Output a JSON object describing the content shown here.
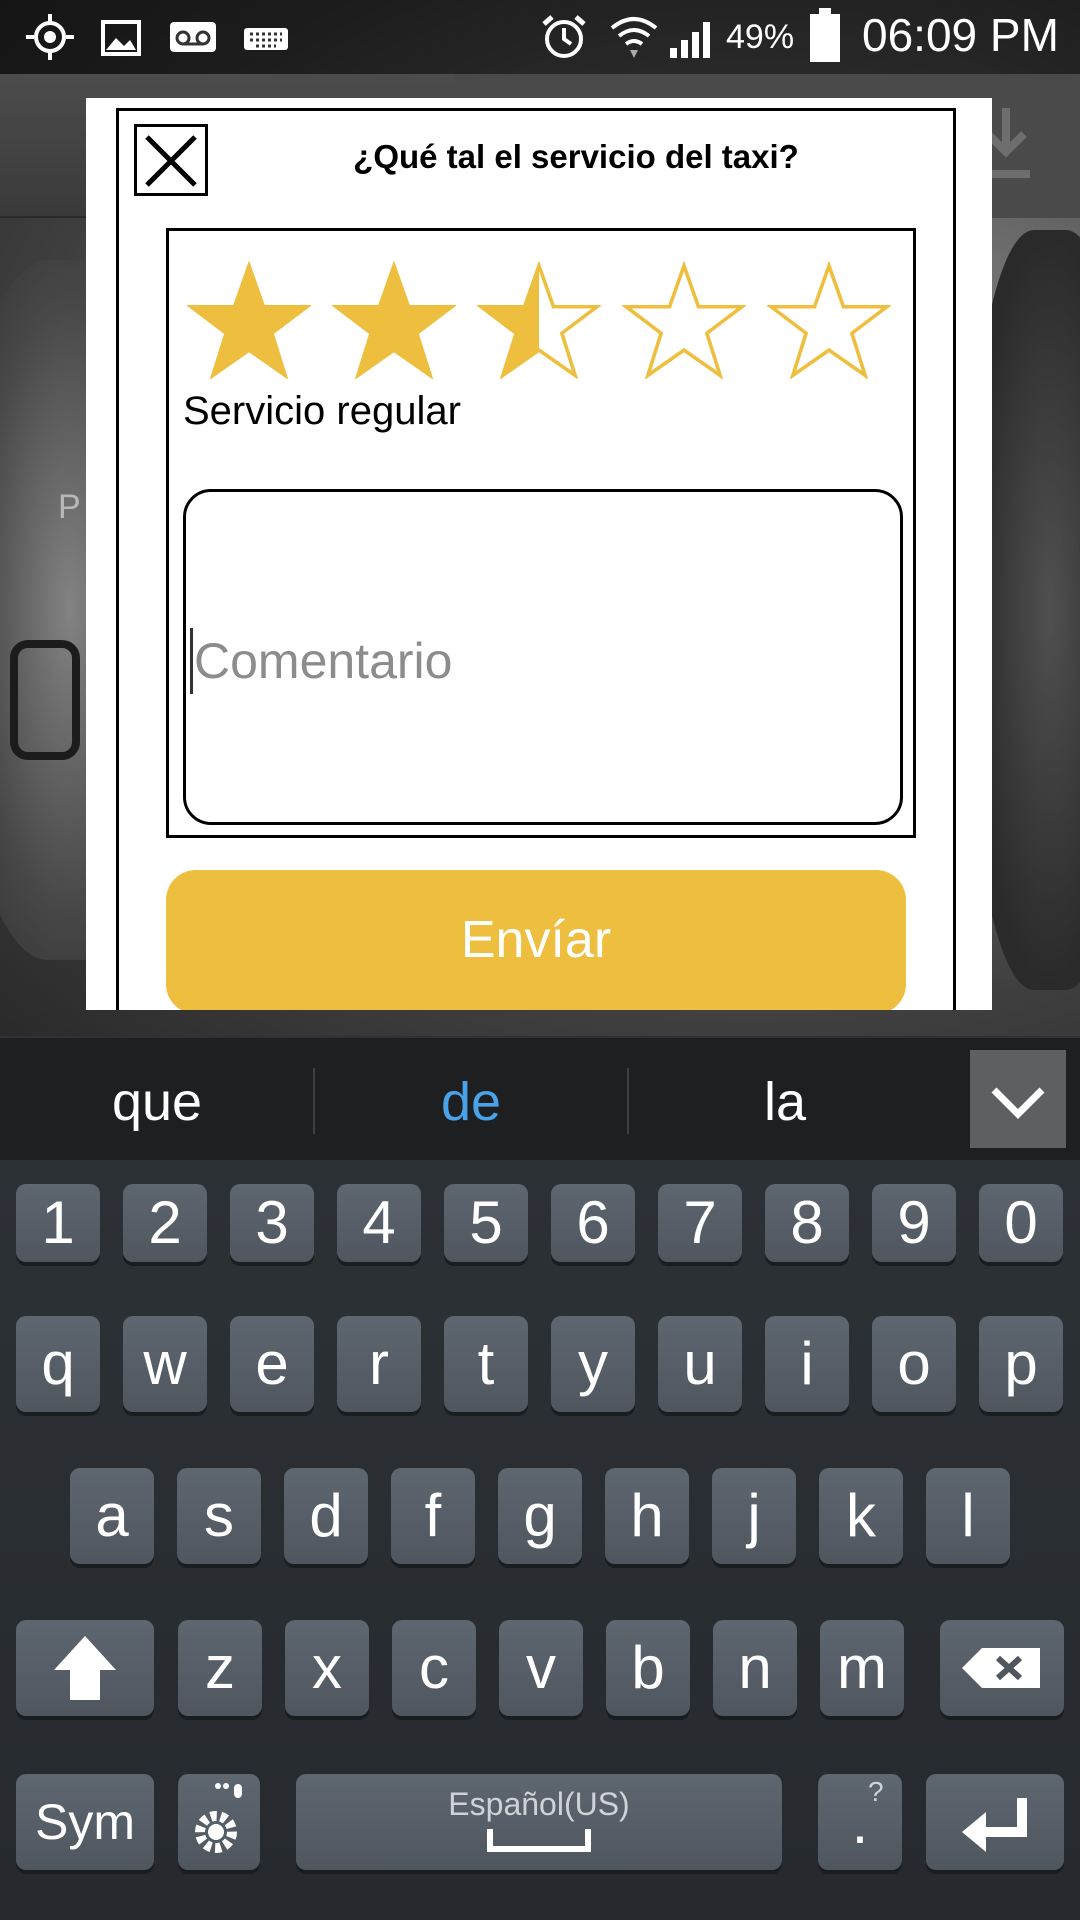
{
  "status_bar": {
    "battery_percent": "49%",
    "time": "06:09 PM",
    "icons": [
      "gps-icon",
      "gallery-icon",
      "voicemail-icon",
      "keyboard-icon",
      "alarm-icon",
      "wifi-icon",
      "signal-icon",
      "battery-icon"
    ]
  },
  "background": {
    "partial_text": "P"
  },
  "dialog": {
    "title": "¿Qué tal el servicio del taxi?",
    "rating": {
      "value": 2.5,
      "max": 5,
      "label": "Servicio regular",
      "star_color": "#eebf3f"
    },
    "comment": {
      "placeholder": "Comentario",
      "value": ""
    },
    "send_label": "Envíar",
    "send_color": "#eebf3f"
  },
  "suggestions": {
    "items": [
      {
        "text": "que",
        "color": "#ffffff"
      },
      {
        "text": "de",
        "color": "#4aa3e8"
      },
      {
        "text": "la",
        "color": "#ffffff"
      }
    ]
  },
  "keyboard": {
    "number_row": [
      "1",
      "2",
      "3",
      "4",
      "5",
      "6",
      "7",
      "8",
      "9",
      "0"
    ],
    "row1": [
      "q",
      "w",
      "e",
      "r",
      "t",
      "y",
      "u",
      "i",
      "o",
      "p"
    ],
    "row2": [
      "a",
      "s",
      "d",
      "f",
      "g",
      "h",
      "j",
      "k",
      "l"
    ],
    "row3": [
      "z",
      "x",
      "c",
      "v",
      "b",
      "n",
      "m"
    ],
    "sym_label": "Sym",
    "space_label": "Español(US)",
    "period_label": ".",
    "period_hint": "?"
  }
}
